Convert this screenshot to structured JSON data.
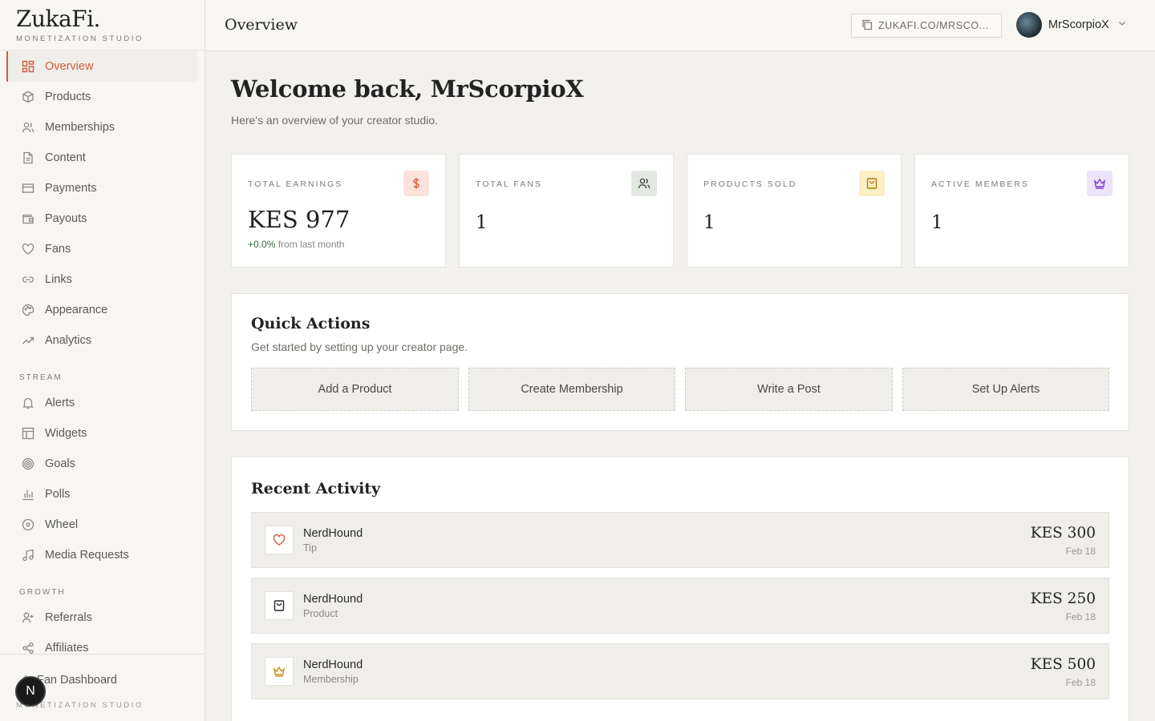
{
  "brand": {
    "name": "ZukaFi.",
    "subtitle": "MONETIZATION STUDIO"
  },
  "nav": {
    "items": [
      {
        "label": "Overview",
        "icon": "grid-icon",
        "active": true
      },
      {
        "label": "Products",
        "icon": "box-icon"
      },
      {
        "label": "Memberships",
        "icon": "users-icon"
      },
      {
        "label": "Content",
        "icon": "document-icon"
      },
      {
        "label": "Payments",
        "icon": "credit-card-icon"
      },
      {
        "label": "Payouts",
        "icon": "wallet-icon"
      },
      {
        "label": "Fans",
        "icon": "heart-icon"
      },
      {
        "label": "Links",
        "icon": "link-icon"
      },
      {
        "label": "Appearance",
        "icon": "palette-icon"
      },
      {
        "label": "Analytics",
        "icon": "trend-icon"
      }
    ],
    "stream_heading": "STREAM",
    "stream_items": [
      {
        "label": "Alerts",
        "icon": "bell-icon"
      },
      {
        "label": "Widgets",
        "icon": "layout-icon"
      },
      {
        "label": "Goals",
        "icon": "target-icon"
      },
      {
        "label": "Polls",
        "icon": "bar-chart-icon"
      },
      {
        "label": "Wheel",
        "icon": "wheel-icon"
      },
      {
        "label": "Media Requests",
        "icon": "music-icon"
      }
    ],
    "growth_heading": "GROWTH",
    "growth_items": [
      {
        "label": "Referrals",
        "icon": "user-plus-icon"
      },
      {
        "label": "Affiliates",
        "icon": "share-icon"
      }
    ]
  },
  "sidebar_footer": {
    "fan_dashboard": "Fan Dashboard",
    "subtitle": "MONETIZATION STUDIO",
    "badge": "N"
  },
  "topbar": {
    "title": "Overview",
    "page_link": "ZUKAFI.CO/MRSCO...",
    "username": "MrScorpioX"
  },
  "welcome": {
    "title": "Welcome back, MrScorpioX",
    "subtitle": "Here's an overview of your creator studio."
  },
  "stats": [
    {
      "label": "TOTAL EARNINGS",
      "value": "KES 977",
      "delta": "+0.0%",
      "delta_text": "from last month",
      "icon": "dollar-icon",
      "icon_bg": "#fbe3dc",
      "icon_color": "#d35a3c"
    },
    {
      "label": "TOTAL FANS",
      "value": "1",
      "icon": "users-icon",
      "icon_bg": "#e4e8e3",
      "icon_color": "#3d4a3f"
    },
    {
      "label": "PRODUCTS SOLD",
      "value": "1",
      "icon": "bag-icon",
      "icon_bg": "#fbefc4",
      "icon_color": "#b07a12"
    },
    {
      "label": "ACTIVE MEMBERS",
      "value": "1",
      "icon": "crown-icon",
      "icon_bg": "#ece4fb",
      "icon_color": "#7b3fd1"
    }
  ],
  "quick_actions": {
    "title": "Quick Actions",
    "subtitle": "Get started by setting up your creator page.",
    "buttons": [
      "Add a Product",
      "Create Membership",
      "Write a Post",
      "Set Up Alerts"
    ]
  },
  "recent_activity": {
    "title": "Recent Activity",
    "items": [
      {
        "name": "NerdHound",
        "type": "Tip",
        "amount": "KES 300",
        "date": "Feb 18",
        "icon": "heart-icon",
        "icon_color": "#d35a3c"
      },
      {
        "name": "NerdHound",
        "type": "Product",
        "amount": "KES 250",
        "date": "Feb 18",
        "icon": "bag-icon",
        "icon_color": "#2a2a2a"
      },
      {
        "name": "NerdHound",
        "type": "Membership",
        "amount": "KES 500",
        "date": "Feb 18",
        "icon": "crown-icon",
        "icon_color": "#c9951a"
      }
    ]
  },
  "colors": {
    "accent": "#d35a3c",
    "positive": "#2f6a3a",
    "background": "#f2f1ee"
  }
}
